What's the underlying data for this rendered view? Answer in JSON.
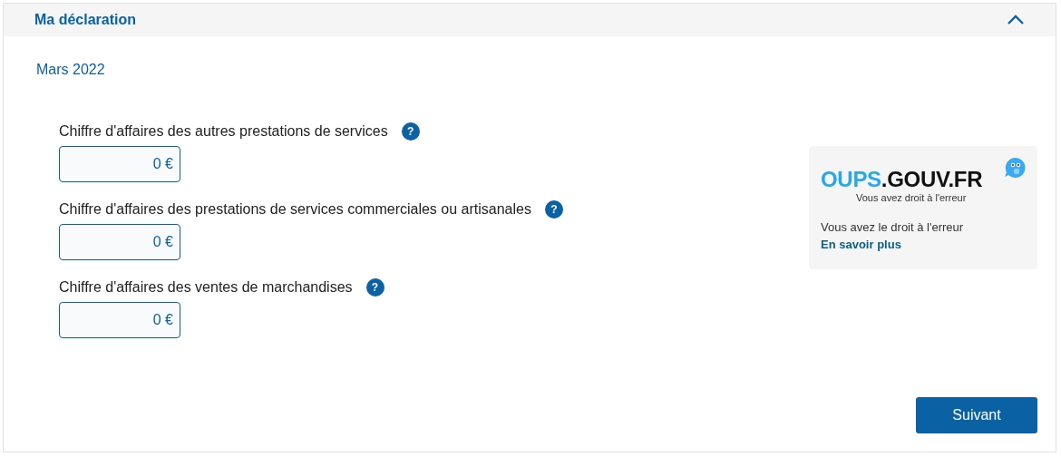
{
  "section": {
    "title": "Ma déclaration",
    "expanded": true
  },
  "period": "Mars 2022",
  "fields": [
    {
      "label": "Chiffre d'affaires des autres prestations de services",
      "help": "?",
      "value": "0 €"
    },
    {
      "label": "Chiffre d'affaires des prestations de services commerciales ou artisanales",
      "help": "?",
      "value": "0 €"
    },
    {
      "label": "Chiffre d'affaires des ventes de marchandises",
      "help": "?",
      "value": "0 €"
    }
  ],
  "promo": {
    "logo_primary": "OUPS",
    "logo_secondary": ".GOUV.FR",
    "tagline": "Vous avez droit à l'erreur",
    "text": "Vous avez le droit à l'erreur",
    "link": "En savoir plus"
  },
  "next_button": "Suivant"
}
